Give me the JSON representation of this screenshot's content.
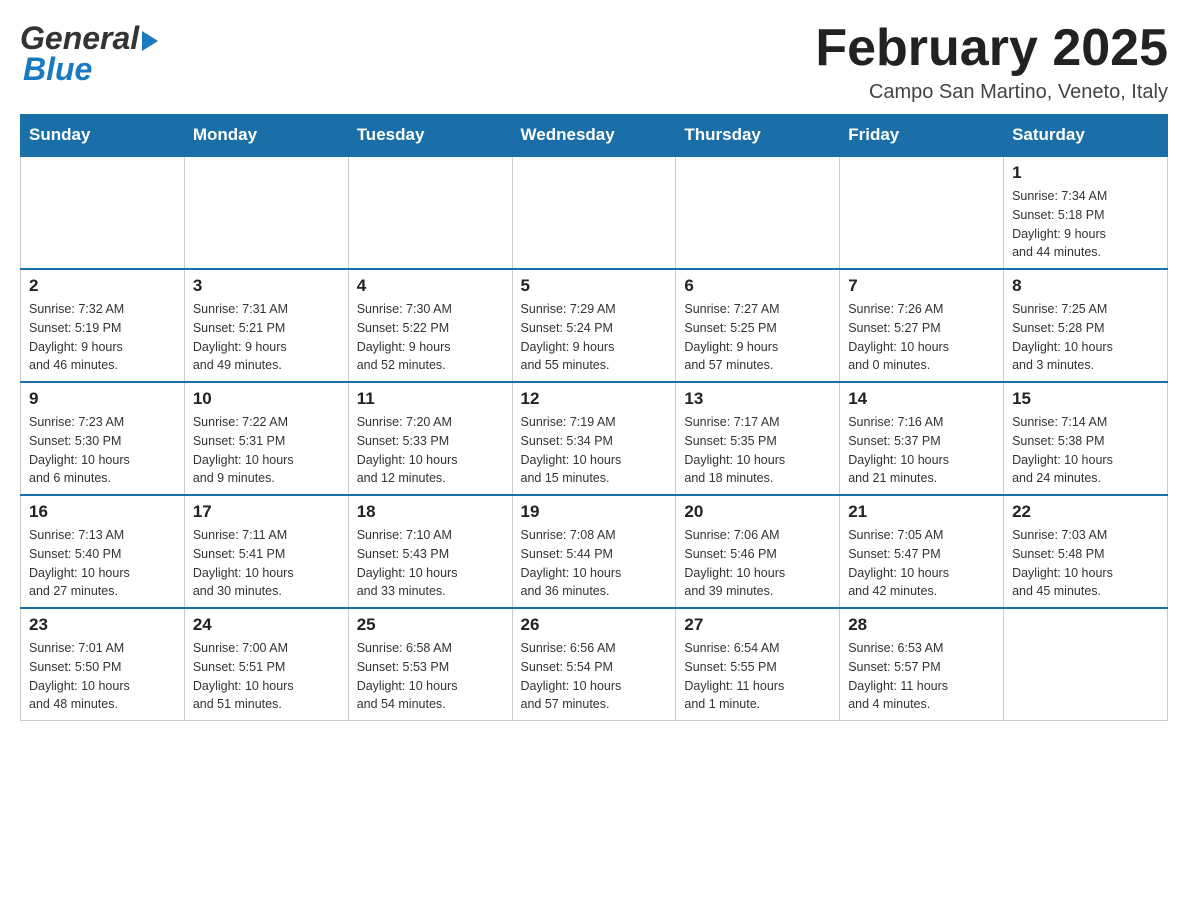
{
  "header": {
    "logo_general": "General",
    "logo_blue": "Blue",
    "title": "February 2025",
    "location": "Campo San Martino, Veneto, Italy"
  },
  "calendar": {
    "days_of_week": [
      "Sunday",
      "Monday",
      "Tuesday",
      "Wednesday",
      "Thursday",
      "Friday",
      "Saturday"
    ],
    "weeks": [
      [
        {
          "day": "",
          "info": ""
        },
        {
          "day": "",
          "info": ""
        },
        {
          "day": "",
          "info": ""
        },
        {
          "day": "",
          "info": ""
        },
        {
          "day": "",
          "info": ""
        },
        {
          "day": "",
          "info": ""
        },
        {
          "day": "1",
          "info": "Sunrise: 7:34 AM\nSunset: 5:18 PM\nDaylight: 9 hours\nand 44 minutes."
        }
      ],
      [
        {
          "day": "2",
          "info": "Sunrise: 7:32 AM\nSunset: 5:19 PM\nDaylight: 9 hours\nand 46 minutes."
        },
        {
          "day": "3",
          "info": "Sunrise: 7:31 AM\nSunset: 5:21 PM\nDaylight: 9 hours\nand 49 minutes."
        },
        {
          "day": "4",
          "info": "Sunrise: 7:30 AM\nSunset: 5:22 PM\nDaylight: 9 hours\nand 52 minutes."
        },
        {
          "day": "5",
          "info": "Sunrise: 7:29 AM\nSunset: 5:24 PM\nDaylight: 9 hours\nand 55 minutes."
        },
        {
          "day": "6",
          "info": "Sunrise: 7:27 AM\nSunset: 5:25 PM\nDaylight: 9 hours\nand 57 minutes."
        },
        {
          "day": "7",
          "info": "Sunrise: 7:26 AM\nSunset: 5:27 PM\nDaylight: 10 hours\nand 0 minutes."
        },
        {
          "day": "8",
          "info": "Sunrise: 7:25 AM\nSunset: 5:28 PM\nDaylight: 10 hours\nand 3 minutes."
        }
      ],
      [
        {
          "day": "9",
          "info": "Sunrise: 7:23 AM\nSunset: 5:30 PM\nDaylight: 10 hours\nand 6 minutes."
        },
        {
          "day": "10",
          "info": "Sunrise: 7:22 AM\nSunset: 5:31 PM\nDaylight: 10 hours\nand 9 minutes."
        },
        {
          "day": "11",
          "info": "Sunrise: 7:20 AM\nSunset: 5:33 PM\nDaylight: 10 hours\nand 12 minutes."
        },
        {
          "day": "12",
          "info": "Sunrise: 7:19 AM\nSunset: 5:34 PM\nDaylight: 10 hours\nand 15 minutes."
        },
        {
          "day": "13",
          "info": "Sunrise: 7:17 AM\nSunset: 5:35 PM\nDaylight: 10 hours\nand 18 minutes."
        },
        {
          "day": "14",
          "info": "Sunrise: 7:16 AM\nSunset: 5:37 PM\nDaylight: 10 hours\nand 21 minutes."
        },
        {
          "day": "15",
          "info": "Sunrise: 7:14 AM\nSunset: 5:38 PM\nDaylight: 10 hours\nand 24 minutes."
        }
      ],
      [
        {
          "day": "16",
          "info": "Sunrise: 7:13 AM\nSunset: 5:40 PM\nDaylight: 10 hours\nand 27 minutes."
        },
        {
          "day": "17",
          "info": "Sunrise: 7:11 AM\nSunset: 5:41 PM\nDaylight: 10 hours\nand 30 minutes."
        },
        {
          "day": "18",
          "info": "Sunrise: 7:10 AM\nSunset: 5:43 PM\nDaylight: 10 hours\nand 33 minutes."
        },
        {
          "day": "19",
          "info": "Sunrise: 7:08 AM\nSunset: 5:44 PM\nDaylight: 10 hours\nand 36 minutes."
        },
        {
          "day": "20",
          "info": "Sunrise: 7:06 AM\nSunset: 5:46 PM\nDaylight: 10 hours\nand 39 minutes."
        },
        {
          "day": "21",
          "info": "Sunrise: 7:05 AM\nSunset: 5:47 PM\nDaylight: 10 hours\nand 42 minutes."
        },
        {
          "day": "22",
          "info": "Sunrise: 7:03 AM\nSunset: 5:48 PM\nDaylight: 10 hours\nand 45 minutes."
        }
      ],
      [
        {
          "day": "23",
          "info": "Sunrise: 7:01 AM\nSunset: 5:50 PM\nDaylight: 10 hours\nand 48 minutes."
        },
        {
          "day": "24",
          "info": "Sunrise: 7:00 AM\nSunset: 5:51 PM\nDaylight: 10 hours\nand 51 minutes."
        },
        {
          "day": "25",
          "info": "Sunrise: 6:58 AM\nSunset: 5:53 PM\nDaylight: 10 hours\nand 54 minutes."
        },
        {
          "day": "26",
          "info": "Sunrise: 6:56 AM\nSunset: 5:54 PM\nDaylight: 10 hours\nand 57 minutes."
        },
        {
          "day": "27",
          "info": "Sunrise: 6:54 AM\nSunset: 5:55 PM\nDaylight: 11 hours\nand 1 minute."
        },
        {
          "day": "28",
          "info": "Sunrise: 6:53 AM\nSunset: 5:57 PM\nDaylight: 11 hours\nand 4 minutes."
        },
        {
          "day": "",
          "info": ""
        }
      ]
    ]
  }
}
